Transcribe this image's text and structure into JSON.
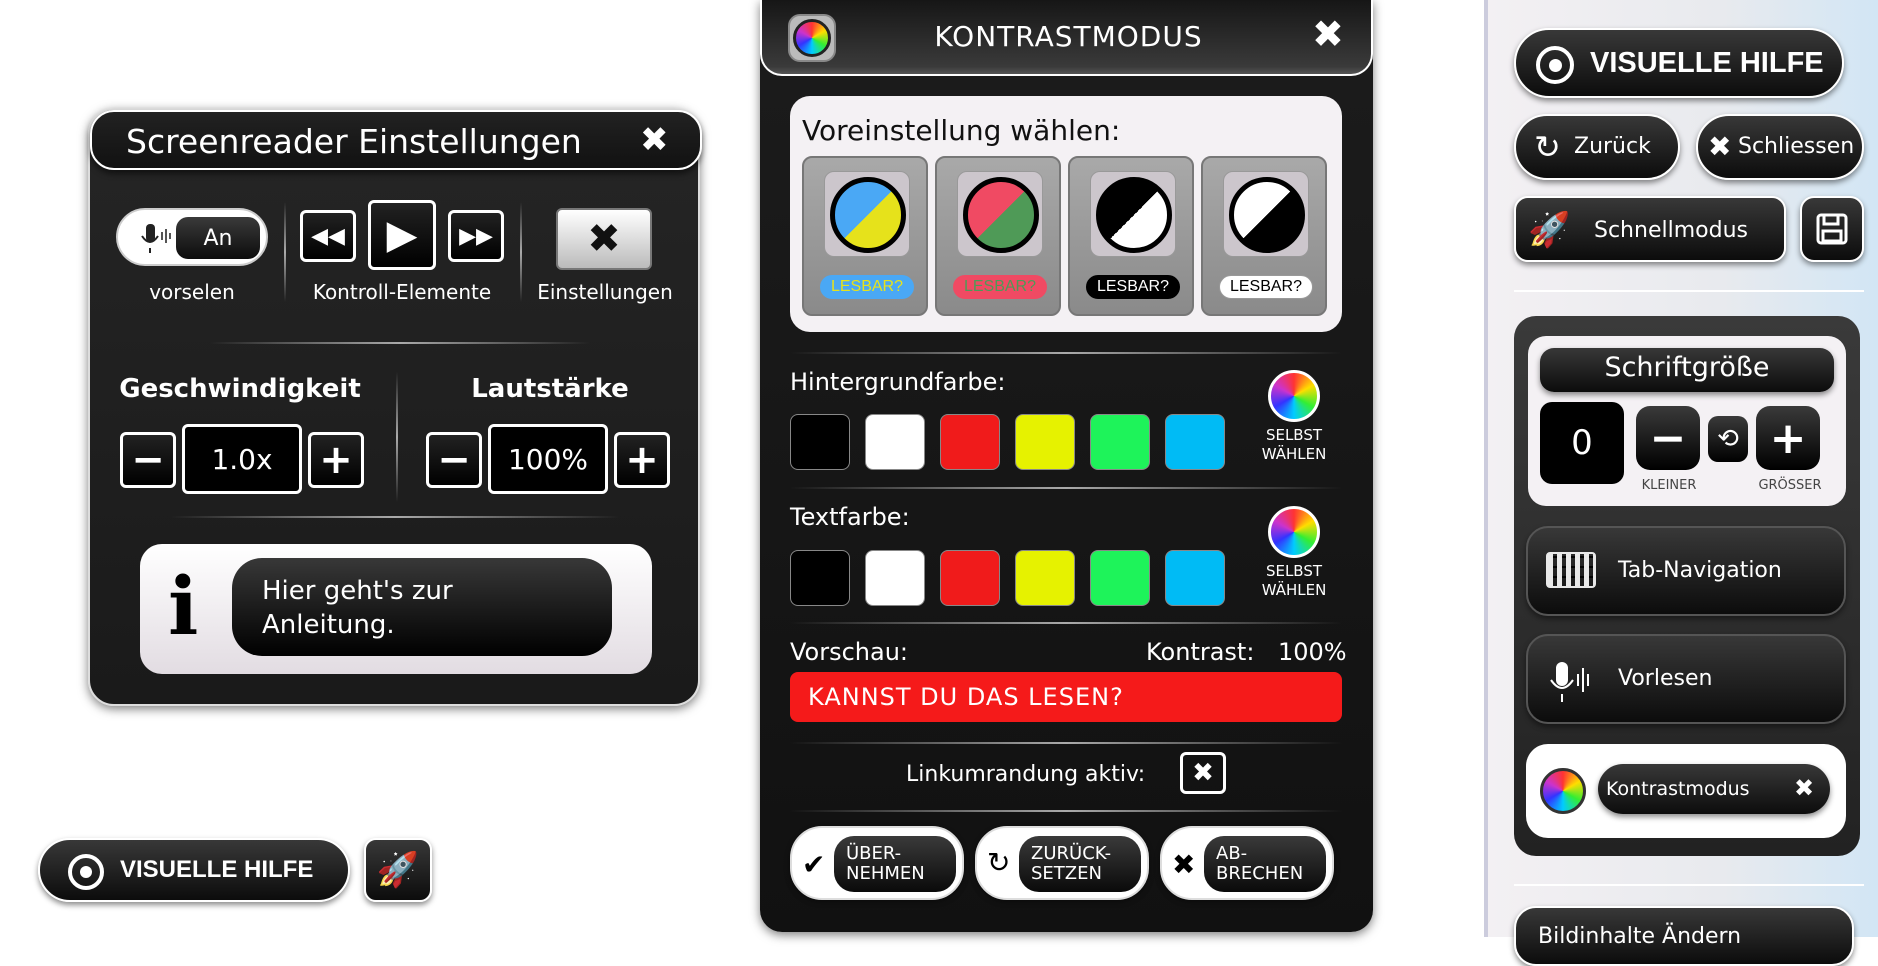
{
  "screenreader": {
    "title": "Screenreader Einstellungen",
    "toggle_state": "An",
    "label_read": "vorselen",
    "label_controls": "Kontroll-Elemente",
    "label_settings": "Einstellungen",
    "speed_label": "Geschwindigkeit",
    "speed_value": "1.0x",
    "volume_label": "Lautstärke",
    "volume_value": "100%",
    "info_text": "Hier geht's zur Anleitung."
  },
  "bottom_bar": {
    "visual_help_label": "VISUELLE HILFE"
  },
  "contrast": {
    "title": "KONTRASTMODUS",
    "preset_heading": "Voreinstellung wählen:",
    "presets": [
      {
        "badge": "LESBAR?",
        "a": "#4aa8f5",
        "b": "#e6e21b",
        "badge_bg": "#4aa8f5",
        "badge_fg": "#e6e21b"
      },
      {
        "badge": "LESBAR?",
        "a": "#f04a63",
        "b": "#4f9a57",
        "badge_bg": "#f04a63",
        "badge_fg": "#4f9a57"
      },
      {
        "badge": "LESBAR?",
        "a": "#000000",
        "b": "#ffffff",
        "badge_bg": "#000000",
        "badge_fg": "#ffffff"
      },
      {
        "badge": "LESBAR?",
        "a": "#ffffff",
        "b": "#000000",
        "badge_bg": "#ffffff",
        "badge_fg": "#000000"
      }
    ],
    "bg_label": "Hintergrundfarbe:",
    "text_label": "Textfarbe:",
    "colors": [
      "#000000",
      "#ffffff",
      "#f01b1b",
      "#e6f200",
      "#1ef35a",
      "#00bbf5"
    ],
    "custom_line1": "SELBST",
    "custom_line2": "WÄHLEN",
    "preview_label": "Vorschau:",
    "contrast_label": "Kontrast:",
    "contrast_value": "100%",
    "preview_text": "KANNST DU DAS LESEN?",
    "preview_bg": "#f51a1a",
    "link_border_label": "Linkumrandung aktiv:",
    "btn_apply_1": "ÜBER-",
    "btn_apply_2": "NEHMEN",
    "btn_reset_1": "ZURÜCK-",
    "btn_reset_2": "SETZEN",
    "btn_cancel_1": "AB-",
    "btn_cancel_2": "BRECHEN"
  },
  "side": {
    "visual_help": "VISUELLE HILFE",
    "back": "Zurück",
    "close": "Schliessen",
    "quick_mode": "Schnellmodus",
    "font_size_title": "Schriftgröße",
    "font_size_value": "0",
    "smaller": "KLEINER",
    "bigger": "GRÖSSER",
    "tab_nav": "Tab-Navigation",
    "read_aloud": "Vorlesen",
    "contrast_mode": "Kontrastmodus",
    "bottom_item": "Bildinhalte Ändern"
  }
}
